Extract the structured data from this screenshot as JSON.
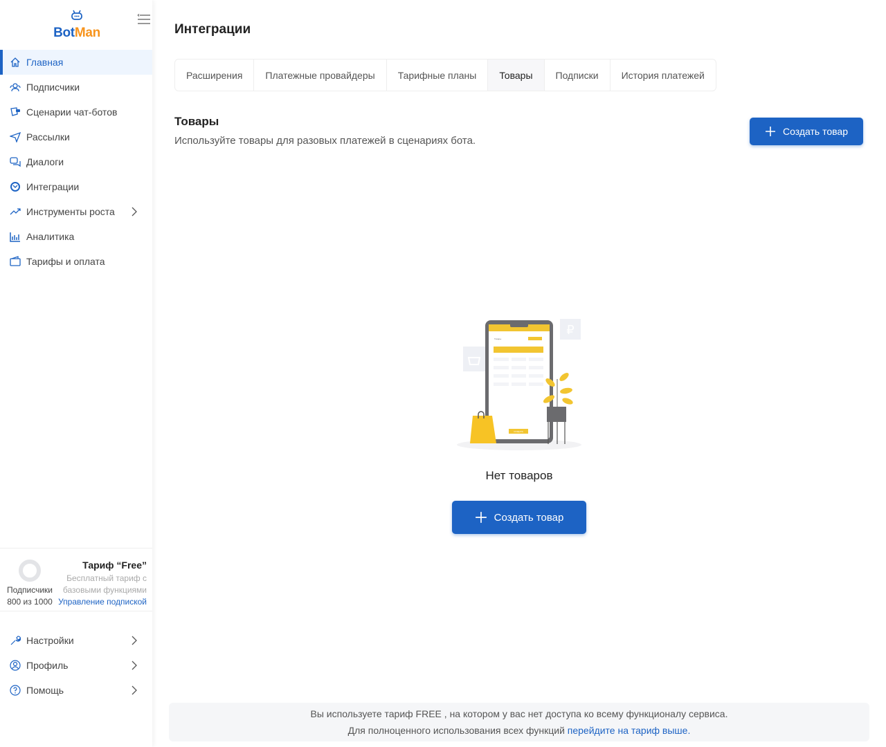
{
  "logo": {
    "part1": "Bot",
    "part2": "Man"
  },
  "sidebar": {
    "items": [
      {
        "label": "Главная"
      },
      {
        "label": "Подписчики"
      },
      {
        "label": "Сценарии чат-ботов"
      },
      {
        "label": "Рассылки"
      },
      {
        "label": "Диалоги"
      },
      {
        "label": "Интеграции"
      },
      {
        "label": "Инструменты роста"
      },
      {
        "label": "Аналитика"
      },
      {
        "label": "Тарифы и оплата"
      }
    ],
    "plan": {
      "subscribers_label": "Подписчики",
      "subscribers_count": "800 из 1000",
      "title": "Тариф “Free”",
      "desc1": "Бесплатный тариф с",
      "desc2": "базовыми функциями",
      "manage": "Управление подпиской"
    },
    "bottom": [
      {
        "label": "Настройки"
      },
      {
        "label": "Профиль"
      },
      {
        "label": "Помощь"
      }
    ]
  },
  "header": {
    "title": "Интеграции"
  },
  "tabs": [
    {
      "label": "Расширения"
    },
    {
      "label": "Платежные провайдеры"
    },
    {
      "label": "Тарифные планы"
    },
    {
      "label": "Товары"
    },
    {
      "label": "Подписки"
    },
    {
      "label": "История платежей"
    }
  ],
  "section": {
    "title": "Товары",
    "desc": "Используйте товары для разовых платежей в сценариях бота.",
    "create": "Создать товар"
  },
  "illustration": {
    "screen_title": "Товары",
    "screen_button": "СОЗДАТЬ"
  },
  "empty": {
    "text": "Нет товаров",
    "create": "Создать товар"
  },
  "banner": {
    "line1": "Вы используете тариф FREE , на котором у вас нет доступа ко всему функционалу сервиса.",
    "line2": "Для полноценного использования всех функций",
    "link": "перейдите на тариф выше."
  },
  "colors": {
    "accent": "#1d63c4",
    "brand_orange": "#f7941d",
    "illustration_yellow": "#f2c531"
  }
}
